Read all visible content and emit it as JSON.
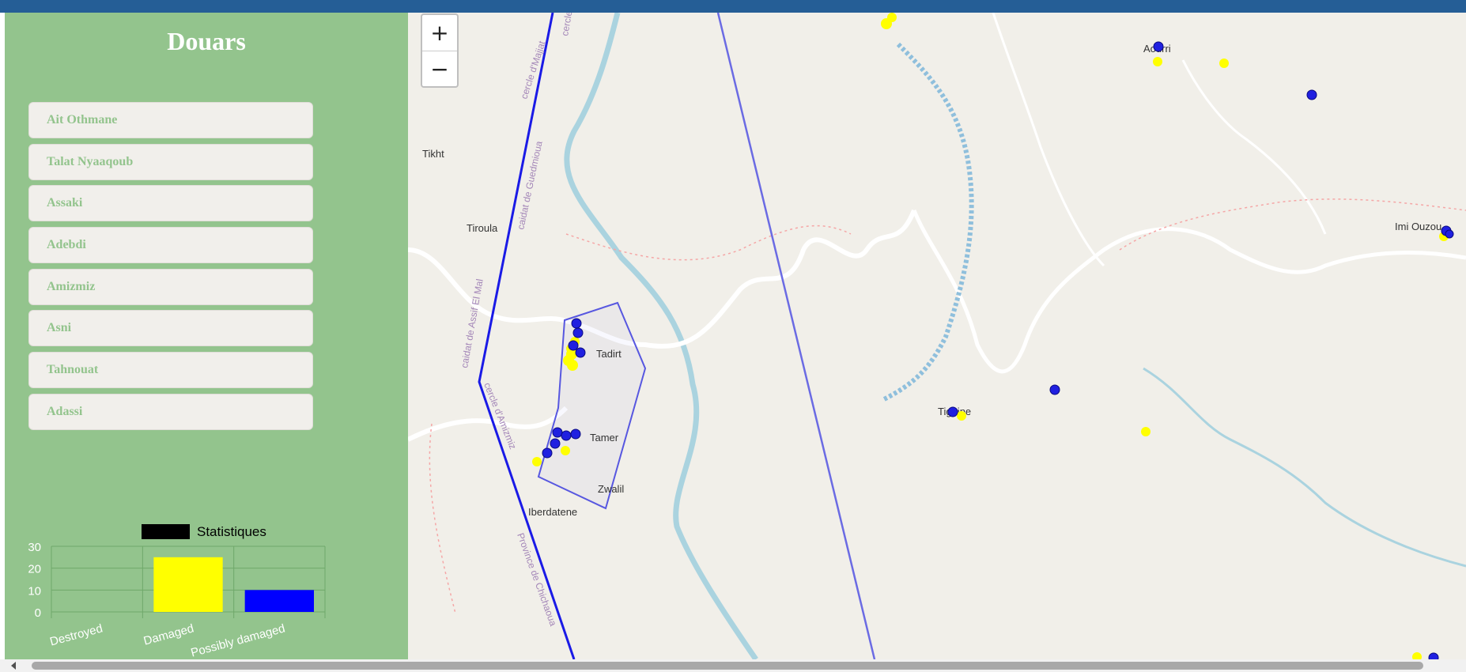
{
  "sidebar": {
    "title": "Douars",
    "items": [
      {
        "label": "Ait Othmane"
      },
      {
        "label": "Talat Nyaaqoub"
      },
      {
        "label": "Assaki"
      },
      {
        "label": "Adebdi"
      },
      {
        "label": "Amizmiz"
      },
      {
        "label": "Asni"
      },
      {
        "label": "Tahnouat"
      },
      {
        "label": "Adassi"
      }
    ]
  },
  "chart_data": {
    "type": "bar",
    "legend": "Statistiques",
    "categories": [
      "Destroyed",
      "Damaged",
      "Possibly damaged"
    ],
    "values": [
      0,
      25,
      10
    ],
    "colors": [
      "#000000",
      "#ffff00",
      "#0000ff"
    ],
    "ylim": [
      0,
      30
    ],
    "yticks": [
      0,
      10,
      20,
      30
    ],
    "grid": true,
    "legend_position": "top"
  },
  "map": {
    "zoom_in_label": "+",
    "zoom_out_label": "−",
    "place_labels": [
      "Tikht",
      "Tiroula",
      "Tadirt",
      "Tamer",
      "Zwalil",
      "Iberdatene",
      "Tiguine",
      "Aourri",
      "Imi Ouzou"
    ],
    "admin_labels": [
      "cercle d'Majjat",
      "cercle",
      "caidat de Guedmioua",
      "caidat de Assif El Mal",
      "cercle d'Amizmiz",
      "Province de Chichaoua"
    ],
    "marker_colors": {
      "damaged": "#ffff00",
      "possibly_damaged": "#0000ff"
    }
  }
}
